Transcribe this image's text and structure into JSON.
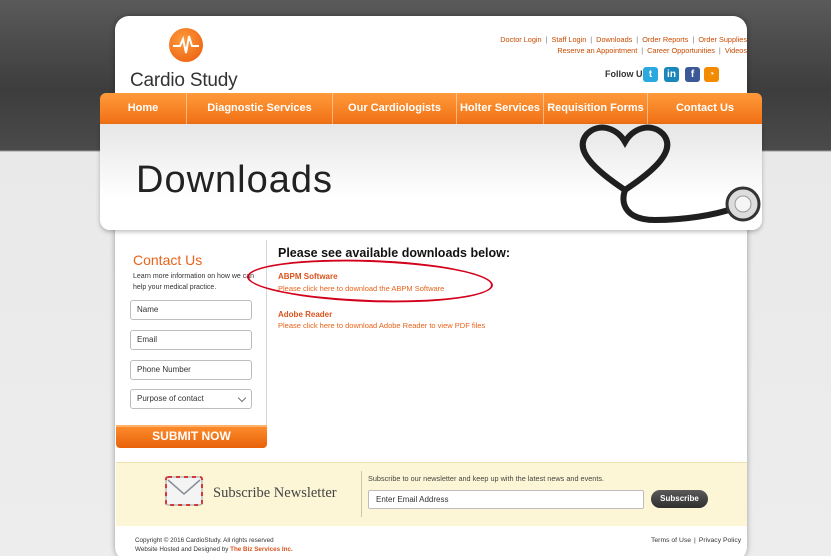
{
  "header": {
    "logo_text": "Cardio Study",
    "top_links_row1": [
      "Doctor Login",
      "Staff Login",
      "Downloads",
      "Order Reports",
      "Order Supplies"
    ],
    "top_links_row2": [
      "Reserve an Appointment",
      "Career Opportunities",
      "Videos"
    ],
    "follow_label": "Follow Us",
    "social": [
      {
        "name": "twitter-icon",
        "glyph": "t"
      },
      {
        "name": "linkedin-icon",
        "glyph": "in"
      },
      {
        "name": "facebook-icon",
        "glyph": "f"
      },
      {
        "name": "rss-icon",
        "glyph": "◔"
      }
    ]
  },
  "nav": {
    "items": [
      "Home",
      "Diagnostic Services",
      "Our Cardiologists",
      "Holter Services",
      "Requisition Forms",
      "Contact Us"
    ]
  },
  "banner": {
    "title": "Downloads"
  },
  "sidebar": {
    "title": "Contact Us",
    "text": "Learn more information on how we can help your medical practice.",
    "name_placeholder": "Name",
    "email_placeholder": "Email",
    "phone_placeholder": "Phone Number",
    "purpose_placeholder": "Purpose of contact",
    "submit_label": "SUBMIT NOW"
  },
  "main": {
    "heading": "Please see available downloads below:",
    "downloads": [
      {
        "title": "ABPM Software",
        "link": "Please click here to download the ABPM Software"
      },
      {
        "title": "Adobe Reader",
        "link": "Please click here to download Adobe Reader to view PDF files"
      }
    ]
  },
  "newsletter": {
    "title": "Subscribe Newsletter",
    "description": "Subscribe to our newsletter and keep up with the latest news and events.",
    "input_placeholder": "Enter Email Address",
    "button_label": "Subscribe"
  },
  "footer": {
    "copyright": "Copyright © 2016 CardioStudy. All rights reserved",
    "hosted_prefix": "Website Hosted and Designed by ",
    "hosted_company": "The Biz Services Inc.",
    "terms": "Terms of Use",
    "privacy": "Privacy Policy"
  },
  "colors": {
    "accent": "#f07014",
    "link": "#e8631a",
    "annotation_circle": "#d3001b"
  }
}
